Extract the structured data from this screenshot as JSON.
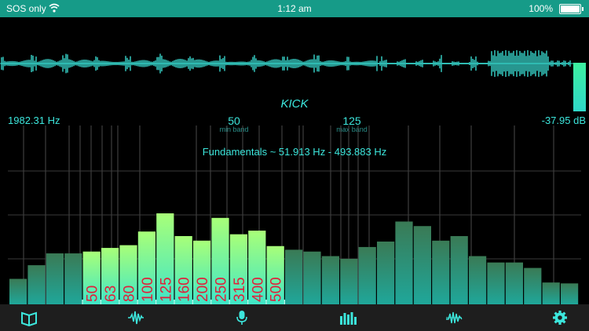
{
  "status_bar": {
    "carrier": "SOS only",
    "time": "1:12 am",
    "battery": "100%"
  },
  "sound_label": "KICK",
  "frequency_readout": "1982.31 Hz",
  "db_readout": "-37.95 dB",
  "min_band": {
    "value": "50",
    "label": "min band"
  },
  "max_band": {
    "value": "125",
    "label": "max band"
  },
  "fundamentals": "Fundamentals  ~  51.913 Hz  -  493.883 Hz",
  "level_meter_fraction": 0.28,
  "colors": {
    "accent": "#3ce6dc",
    "highlight_band": "#2fe0b0",
    "bar_label": "#e0203a",
    "status_bar": "#169b88"
  },
  "chart_data": {
    "type": "bar",
    "band_labels": [
      "50",
      "63",
      "80",
      "100",
      "125",
      "160",
      "200",
      "250",
      "315",
      "400",
      "500"
    ],
    "highlighted_range": [
      4,
      14
    ],
    "values": [
      0.28,
      0.43,
      0.56,
      0.56,
      0.58,
      0.62,
      0.65,
      0.8,
      1.0,
      0.75,
      0.7,
      0.95,
      0.77,
      0.81,
      0.64,
      0.6,
      0.58,
      0.53,
      0.5,
      0.63,
      0.69,
      0.91,
      0.86,
      0.7,
      0.75,
      0.53,
      0.46,
      0.46,
      0.4,
      0.24,
      0.23
    ],
    "ylim": [
      0,
      1
    ]
  },
  "tabs": [
    {
      "name": "book-icon"
    },
    {
      "name": "waveform-icon"
    },
    {
      "name": "microphone-icon"
    },
    {
      "name": "spectrum-icon"
    },
    {
      "name": "signal-icon"
    },
    {
      "name": "gear-icon"
    }
  ]
}
